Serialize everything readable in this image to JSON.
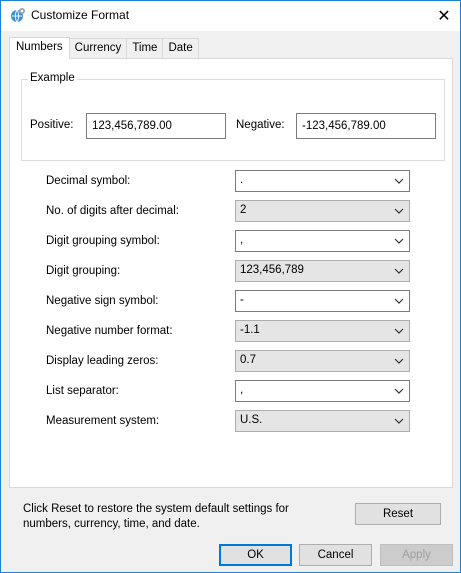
{
  "window": {
    "title": "Customize Format",
    "close_glyph": "✕"
  },
  "tabs": [
    {
      "label": "Numbers",
      "active": true
    },
    {
      "label": "Currency",
      "active": false
    },
    {
      "label": "Time",
      "active": false
    },
    {
      "label": "Date",
      "active": false
    }
  ],
  "example": {
    "group_label": "Example",
    "positive_label": "Positive:",
    "positive_value": "123,456,789.00",
    "negative_label": "Negative:",
    "negative_value": "-123,456,789.00"
  },
  "settings": [
    {
      "label": "Decimal symbol:",
      "value": ".",
      "editable": true
    },
    {
      "label": "No. of digits after decimal:",
      "value": "2",
      "editable": false
    },
    {
      "label": "Digit grouping symbol:",
      "value": ",",
      "editable": true
    },
    {
      "label": "Digit grouping:",
      "value": "123,456,789",
      "editable": false
    },
    {
      "label": "Negative sign symbol:",
      "value": "-",
      "editable": true
    },
    {
      "label": "Negative number format:",
      "value": "-1.1",
      "editable": false
    },
    {
      "label": "Display leading zeros:",
      "value": "0.7",
      "editable": false
    },
    {
      "label": "List separator:",
      "value": ",",
      "editable": true
    },
    {
      "label": "Measurement system:",
      "value": "U.S.",
      "editable": false
    }
  ],
  "reset_note": {
    "line1": "Click Reset to restore the system default settings for",
    "line2": "numbers, currency, time, and date."
  },
  "buttons": {
    "reset": "Reset",
    "ok": "OK",
    "cancel": "Cancel",
    "apply": "Apply"
  },
  "icons": {
    "app": "globe-settings-icon",
    "close": "close-icon",
    "dropdown": "chevron-down-icon"
  },
  "colors": {
    "accent": "#0078d7",
    "window_border": "#1883d7",
    "dialog_bg": "#f0f0f0"
  }
}
